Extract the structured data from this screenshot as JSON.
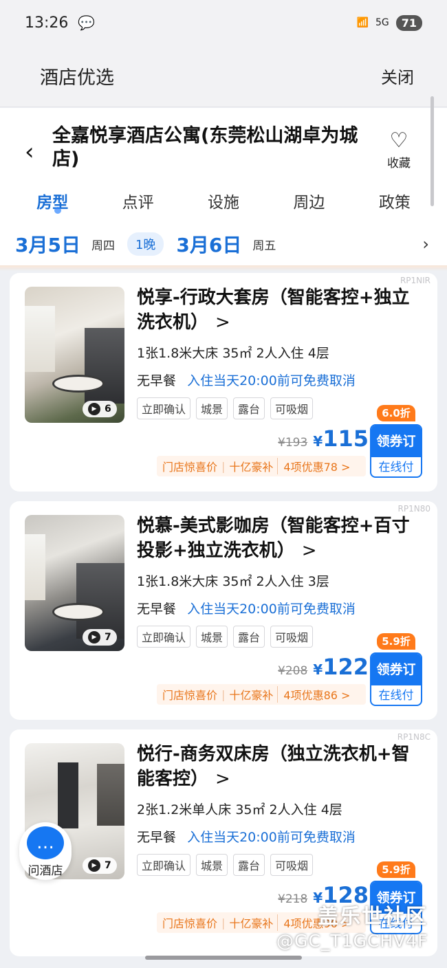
{
  "status_bar": {
    "time": "13:26",
    "network": "5G",
    "battery": "71"
  },
  "mini_header": {
    "title": "酒店优选",
    "close_label": "关闭"
  },
  "hotel": {
    "name": "全嘉悦享酒店公寓(东莞松山湖卓为城店)",
    "favorite_label": "收藏"
  },
  "tabs": [
    {
      "label": "房型",
      "active": true
    },
    {
      "label": "点评"
    },
    {
      "label": "设施"
    },
    {
      "label": "周边"
    },
    {
      "label": "政策"
    }
  ],
  "dates": {
    "checkin": "3月5日",
    "checkin_weekday": "周四",
    "nights": "1晚",
    "checkout": "3月6日",
    "checkout_weekday": "周五"
  },
  "rooms": [
    {
      "code": "RP1NIR",
      "title": "悦享-行政大套房（智能客控+独立洗衣机）",
      "specs": "1张1.8米大床 35㎡ 2人入住 4层",
      "breakfast": "无早餐",
      "cancel_policy": "入住当天20:00前可免费取消",
      "tags": [
        "立即确认",
        "城景",
        "露台",
        "可吸烟"
      ],
      "photo_count": "6",
      "discount": "6.0折",
      "orig_price": "¥193",
      "price_symbol": "¥",
      "price": "115",
      "book_label": "领券订",
      "pay_label": "在线付",
      "promo_1": "门店惊喜价",
      "promo_2": "十亿豪补",
      "promo_more": "4项优惠78 >"
    },
    {
      "code": "RP1N80",
      "title": "悦慕-美式影咖房（智能客控+百寸投影+独立洗衣机）",
      "specs": "1张1.8米大床 35㎡ 2人入住 3层",
      "breakfast": "无早餐",
      "cancel_policy": "入住当天20:00前可免费取消",
      "tags": [
        "立即确认",
        "城景",
        "露台",
        "可吸烟"
      ],
      "photo_count": "7",
      "discount": "5.9折",
      "orig_price": "¥208",
      "price_symbol": "¥",
      "price": "122",
      "book_label": "领券订",
      "pay_label": "在线付",
      "promo_1": "门店惊喜价",
      "promo_2": "十亿豪补",
      "promo_more": "4项优惠86 >"
    },
    {
      "code": "RP1N8C",
      "title": "悦行-商务双床房（独立洗衣机+智能客控）",
      "specs": "2张1.2米单人床 35㎡ 2人入住 4层",
      "breakfast": "无早餐",
      "cancel_policy": "入住当天20:00前可免费取消",
      "tags": [
        "立即确认",
        "城景",
        "露台",
        "可吸烟"
      ],
      "photo_count": "7",
      "discount": "5.9折",
      "orig_price": "¥218",
      "price_symbol": "¥",
      "price": "128",
      "book_label": "领券订",
      "pay_label": "在线付",
      "promo_1": "门店惊喜价",
      "promo_2": "十亿豪补",
      "promo_more": "4项优惠90 >"
    }
  ],
  "float_button": {
    "label": "问酒店"
  },
  "watermark": {
    "line1": "盖乐世社区",
    "line2": "@GC_T1GCHV4F"
  },
  "colors": {
    "accent": "#1a6fd6",
    "discount": "#ff7a1a",
    "promo_text": "#e8751a"
  }
}
